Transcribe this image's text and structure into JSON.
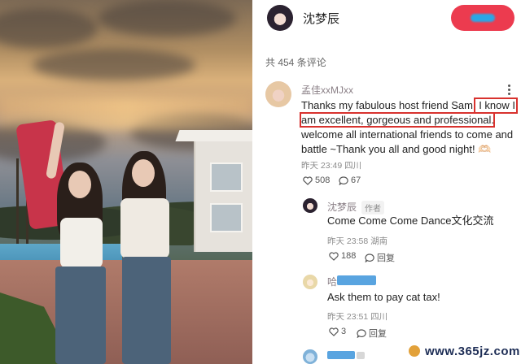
{
  "header": {
    "author_name": "沈梦辰"
  },
  "comments_count": "共 454 条评论",
  "comments": [
    {
      "username": "孟佳xxMJxx",
      "text_line1": "Thanks my fabulous host friend Sam! I know I",
      "text_line2": "am excellent, gorgeous and professional.",
      "text_line3": "welcome all international friends to come and",
      "text_line4": "battle ~Thank you all and good night! 🫶🏻",
      "time": "昨天 23:49",
      "location": "四川",
      "likes": "508",
      "replies": "67"
    }
  ],
  "replies": [
    {
      "username": "沈梦辰",
      "author_tag": "作者",
      "text": "Come Come Come Dance文化交流",
      "time": "昨天 23:58",
      "location": "湖南",
      "likes": "188",
      "reply_label": "回复"
    },
    {
      "username": "哈",
      "text": "Ask them to pay cat tax!",
      "time": "昨天 23:51",
      "location": "四川",
      "likes": "3",
      "reply_label": "回复"
    }
  ],
  "watermark": {
    "text": "www.365jz.com"
  },
  "icons": {
    "like": "heart-outline-icon",
    "reply": "speech-bubble-icon",
    "more": "vertical-dots-icon"
  },
  "colors": {
    "follow_button": "#ec3b4f",
    "highlight_box": "#d8322e",
    "name_text": "#8a7f86"
  }
}
